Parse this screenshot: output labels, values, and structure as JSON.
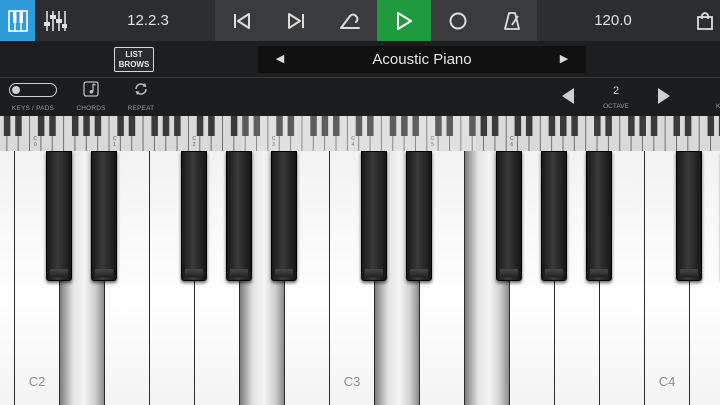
{
  "transport": {
    "position": "12.2.3",
    "tempo": "120.0"
  },
  "instrument": {
    "list_browse_label_1": "LIST",
    "list_browse_label_2": "BROWS",
    "preset_name": "Acoustic Piano"
  },
  "controls": {
    "keys_pads_label": "KEYS / PADS",
    "chords_label": "CHORDS",
    "repeat_label": "REPEAT",
    "octave_value": "2",
    "octave_label": "OCTAVE",
    "edge_label": "K"
  },
  "mini_keyboard": {
    "labels": [
      "C",
      "C",
      "C",
      "C",
      "C",
      "C",
      "C"
    ],
    "octave_numbers": [
      "0",
      "1",
      "2",
      "3",
      "4",
      "5",
      "6"
    ]
  },
  "keyboard": {
    "white_key_labels": [
      {
        "index": 1,
        "label": "C2"
      },
      {
        "index": 8,
        "label": "C3"
      },
      {
        "index": 15,
        "label": "C4"
      }
    ],
    "pressed_white_keys": [
      2,
      6,
      9,
      11
    ]
  },
  "colors": {
    "accent_blue": "#2f9bd8",
    "play_green": "#1f9a3f"
  }
}
